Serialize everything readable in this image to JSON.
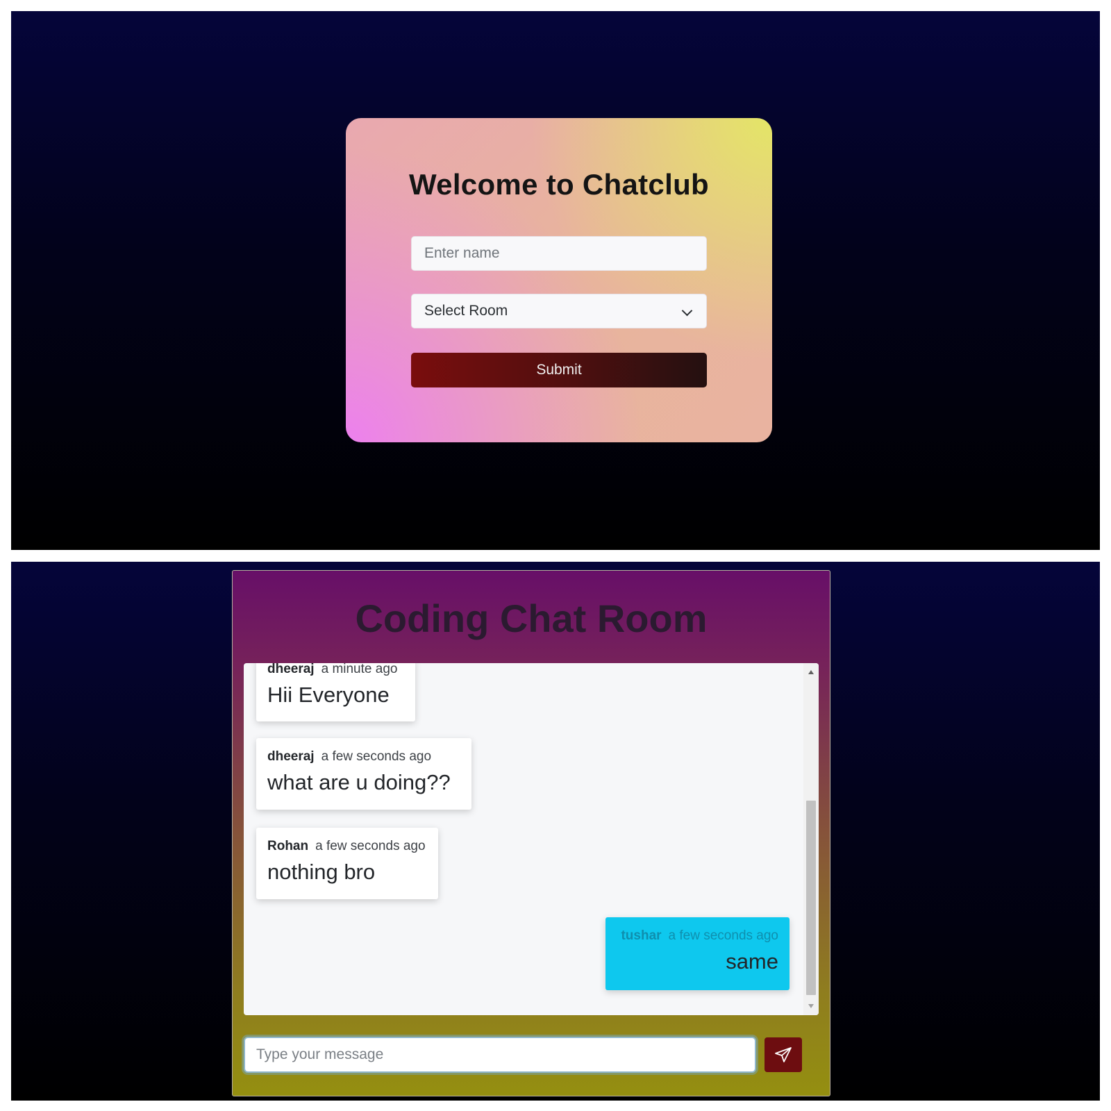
{
  "login": {
    "title": "Welcome to Chatclub",
    "name_placeholder": "Enter name",
    "room_select_value": "Select Room",
    "submit_label": "Submit"
  },
  "chat": {
    "room_title": "Coding Chat Room",
    "messages": [
      {
        "user": "dheeraj",
        "time": "a minute ago",
        "text": "Hii Everyone",
        "self": false
      },
      {
        "user": "dheeraj",
        "time": "a few seconds ago",
        "text": "what are u doing??",
        "self": false
      },
      {
        "user": "Rohan",
        "time": "a few seconds ago",
        "text": "nothing bro",
        "self": false
      },
      {
        "user": "tushar",
        "time": "a few seconds ago",
        "text": "same",
        "self": true
      }
    ],
    "composer_placeholder": "Type your message",
    "send_icon": "send-icon"
  },
  "colors": {
    "send_button": "#6d0d10",
    "self_message": "#0ec8ee",
    "submit_button": "#7a0d0d"
  }
}
